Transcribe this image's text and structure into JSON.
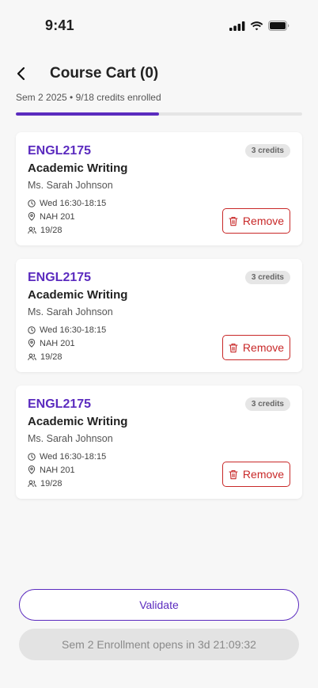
{
  "status_bar": {
    "time": "9:41"
  },
  "header": {
    "title": "Course Cart (0)"
  },
  "subtitle": "Sem 2 2025 • 9/18 credits enrolled",
  "progress": {
    "fraction": 0.5
  },
  "colors": {
    "accent": "#5b2bbf",
    "danger": "#c82828"
  },
  "cards": [
    {
      "code": "ENGL2175",
      "title": "Academic Writing",
      "instructor": "Ms. Sarah Johnson",
      "time": "Wed 16:30-18:15",
      "location": "NAH 201",
      "capacity": "19/28",
      "credits": "3 credits",
      "remove_label": "Remove"
    },
    {
      "code": "ENGL2175",
      "title": "Academic Writing",
      "instructor": "Ms. Sarah Johnson",
      "time": "Wed 16:30-18:15",
      "location": "NAH 201",
      "capacity": "19/28",
      "credits": "3 credits",
      "remove_label": "Remove"
    },
    {
      "code": "ENGL2175",
      "title": "Academic Writing",
      "instructor": "Ms. Sarah Johnson",
      "time": "Wed 16:30-18:15",
      "location": "NAH 201",
      "capacity": "19/28",
      "credits": "3 credits",
      "remove_label": "Remove"
    }
  ],
  "footer": {
    "validate_label": "Validate",
    "enroll_label": "Sem 2 Enrollment opens in 3d 21:09:32"
  },
  "icons": {
    "back": "chevron-left-icon",
    "clock": "clock-icon",
    "location": "map-pin-icon",
    "people": "users-icon",
    "trash": "trash-icon"
  }
}
